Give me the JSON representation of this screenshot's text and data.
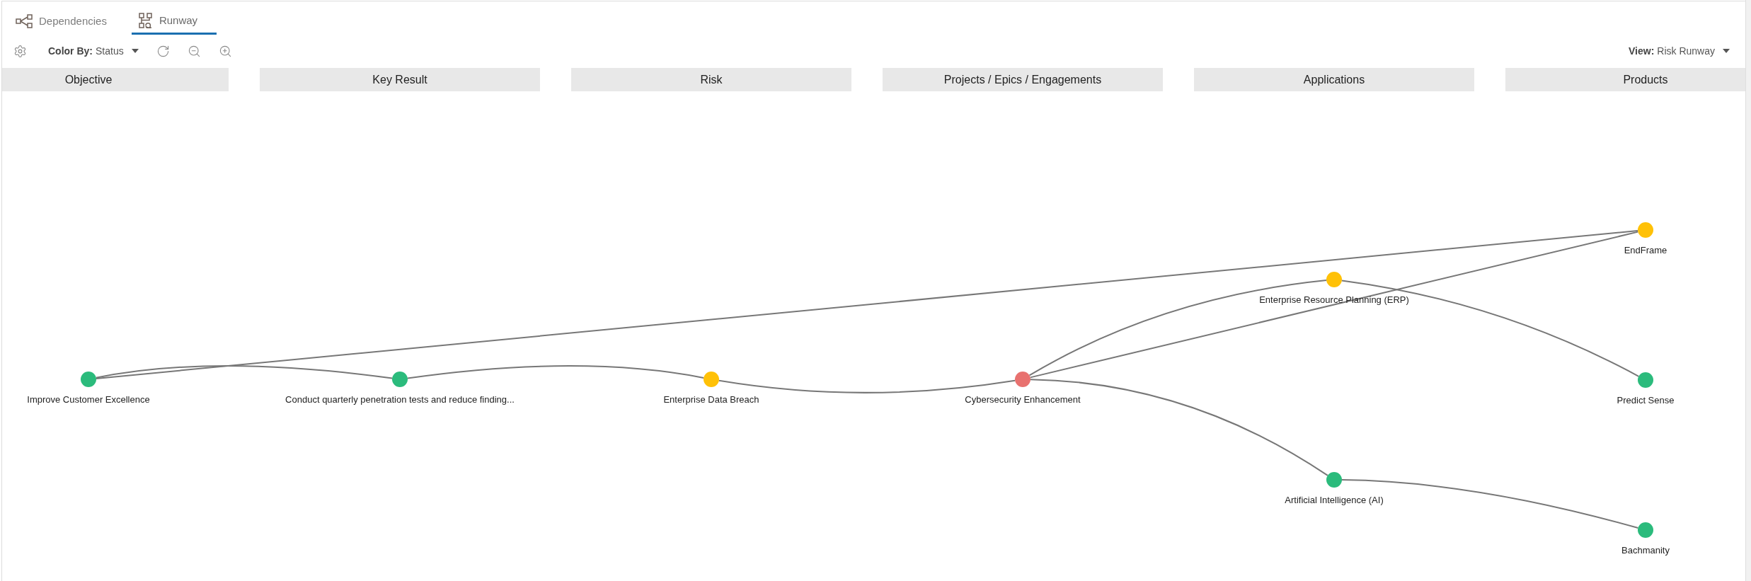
{
  "tabs": [
    {
      "label": "Dependencies",
      "selected": false
    },
    {
      "label": "Runway",
      "selected": true
    }
  ],
  "toolbar": {
    "color_by": {
      "label": "Color By:",
      "value": "Status"
    },
    "view": {
      "label": "View:",
      "value": "Risk Runway"
    }
  },
  "columns": [
    {
      "title": "Objective",
      "nodes": [
        {
          "label": "Improve Customer Excellence",
          "color": "#2bbb7c"
        }
      ]
    },
    {
      "title": "Key Result",
      "nodes": [
        {
          "label": "Conduct quarterly penetration tests and reduce finding...",
          "color": "#2bbb7c"
        }
      ]
    },
    {
      "title": "Risk",
      "nodes": [
        {
          "label": "Enterprise Data Breach",
          "color": "#ffc107"
        }
      ]
    },
    {
      "title": "Projects / Epics / Engagements",
      "nodes": [
        {
          "label": "Cybersecurity Enhancement",
          "color": "#e8716f"
        }
      ]
    },
    {
      "title": "Applications",
      "nodes": [
        {
          "label": "Enterprise Resource Planning (ERP)",
          "color": "#ffc107"
        },
        {
          "label": "Artificial Intelligence (AI)",
          "color": "#2bbb7c"
        }
      ]
    },
    {
      "title": "Products",
      "nodes": [
        {
          "label": "EndFrame",
          "color": "#ffc107"
        },
        {
          "label": "Predict Sense",
          "color": "#2bbb7c"
        },
        {
          "label": "Bachmanity",
          "color": "#2bbb7c"
        }
      ]
    }
  ]
}
